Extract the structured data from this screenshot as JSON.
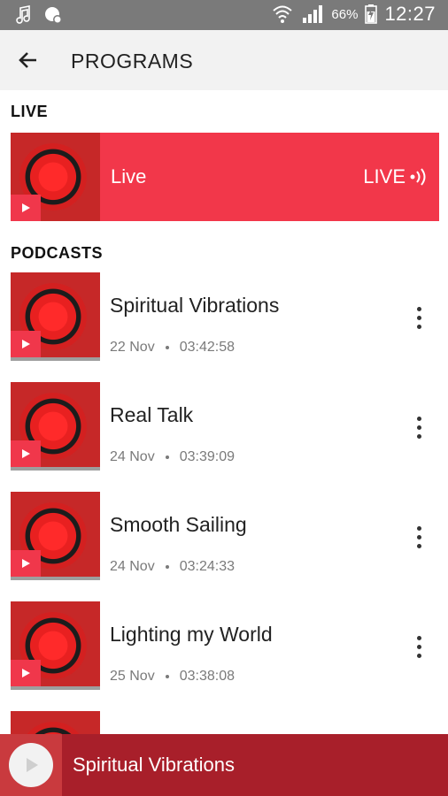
{
  "status_bar": {
    "battery": "66%",
    "time": "12:27",
    "icons": [
      "music-note-icon",
      "voice-bubble-icon",
      "wifi-icon",
      "signal-icon",
      "battery-charging-icon"
    ]
  },
  "app_bar": {
    "title": "PROGRAMS",
    "back_icon": "arrow-left-icon"
  },
  "live_section": {
    "header": "LIVE",
    "item": {
      "label": "Live",
      "badge": "LIVE"
    }
  },
  "podcasts_section": {
    "header": "PODCASTS",
    "items": [
      {
        "title": "Spiritual Vibrations",
        "date": "22 Nov",
        "duration": "03:42:58"
      },
      {
        "title": "Real Talk",
        "date": "24 Nov",
        "duration": "03:39:09"
      },
      {
        "title": "Smooth Sailing",
        "date": "24 Nov",
        "duration": "03:24:33"
      },
      {
        "title": "Lighting my World",
        "date": "25 Nov",
        "duration": "03:38:08"
      }
    ]
  },
  "player": {
    "title": "Spiritual Vibrations"
  },
  "colors": {
    "live_bg": "#f2374a",
    "player_bg": "#a81f2a",
    "status_bg": "#7a7a7a"
  }
}
